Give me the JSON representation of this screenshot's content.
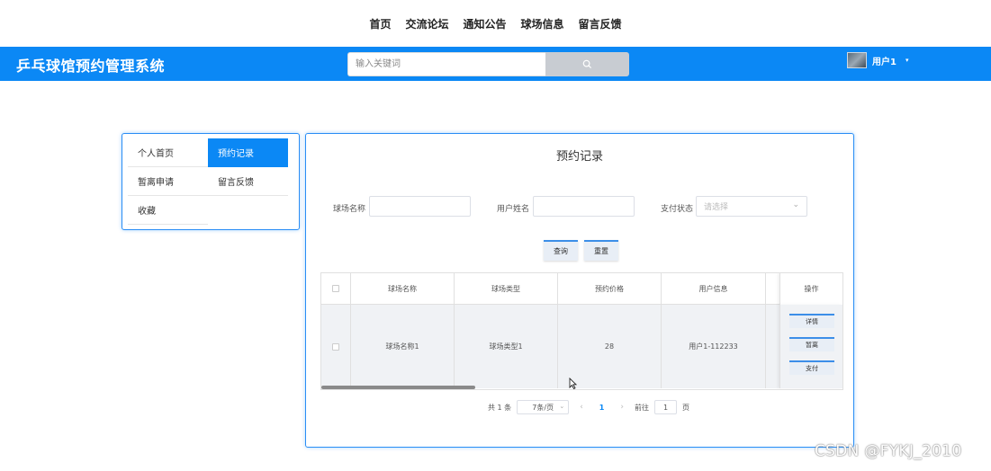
{
  "topnav": {
    "items": [
      "首页",
      "交流论坛",
      "通知公告",
      "球场信息",
      "留言反馈"
    ]
  },
  "header": {
    "title": "乒乓球馆预约管理系统",
    "search_placeholder": "输入关键词",
    "search_icon": "search-icon",
    "user_name": "用户1",
    "caret": "▾"
  },
  "sidebar": {
    "items": [
      {
        "label": "个人首页"
      },
      {
        "label": "预约记录"
      },
      {
        "label": "暂离申请"
      },
      {
        "label": "留言反馈"
      },
      {
        "label": "收藏"
      }
    ],
    "active_index": 1
  },
  "main": {
    "title": "预约记录",
    "filters": {
      "venue_label": "球场名称",
      "user_label": "用户姓名",
      "pay_label": "支付状态",
      "pay_placeholder": "请选择"
    },
    "buttons": {
      "query": "查询",
      "reset": "重置"
    },
    "table": {
      "headers": [
        "球场名称",
        "球场类型",
        "预约价格",
        "用户信息",
        "操作"
      ],
      "rows": [
        {
          "venue": "球场名称1",
          "type": "球场类型1",
          "price": "28",
          "user": "用户1-112233"
        }
      ],
      "row_actions": [
        "详情",
        "暂离",
        "支付"
      ]
    },
    "pagination": {
      "total": "共 1 条",
      "page_size": "7条/页",
      "current_page": "1",
      "goto_label": "前往",
      "goto_value": "1",
      "page_suffix": "页"
    }
  },
  "watermark": "CSDN @FYKJ_2010",
  "colors": {
    "accent": "#0b88f5",
    "button_bg": "#e8eef6"
  }
}
